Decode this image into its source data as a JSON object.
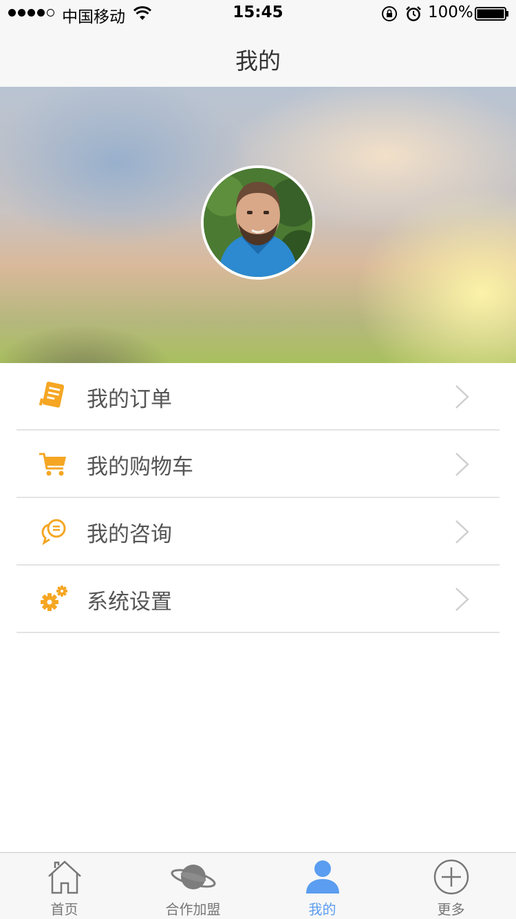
{
  "status_bar": {
    "carrier": "中国移动",
    "time": "15:45",
    "battery": "100%"
  },
  "nav": {
    "title": "我的"
  },
  "menu": {
    "items": [
      {
        "label": "我的订单",
        "icon": "order-icon"
      },
      {
        "label": "我的购物车",
        "icon": "cart-icon"
      },
      {
        "label": "我的咨询",
        "icon": "consult-icon"
      },
      {
        "label": "系统设置",
        "icon": "settings-icon"
      }
    ],
    "accent_color": "#f5a623"
  },
  "tabs": {
    "items": [
      {
        "label": "首页",
        "icon": "home-icon"
      },
      {
        "label": "合作加盟",
        "icon": "planet-icon"
      },
      {
        "label": "我的",
        "icon": "profile-icon",
        "active": true
      },
      {
        "label": "更多",
        "icon": "plus-circle-icon"
      }
    ],
    "active_color": "#5b9df0"
  }
}
